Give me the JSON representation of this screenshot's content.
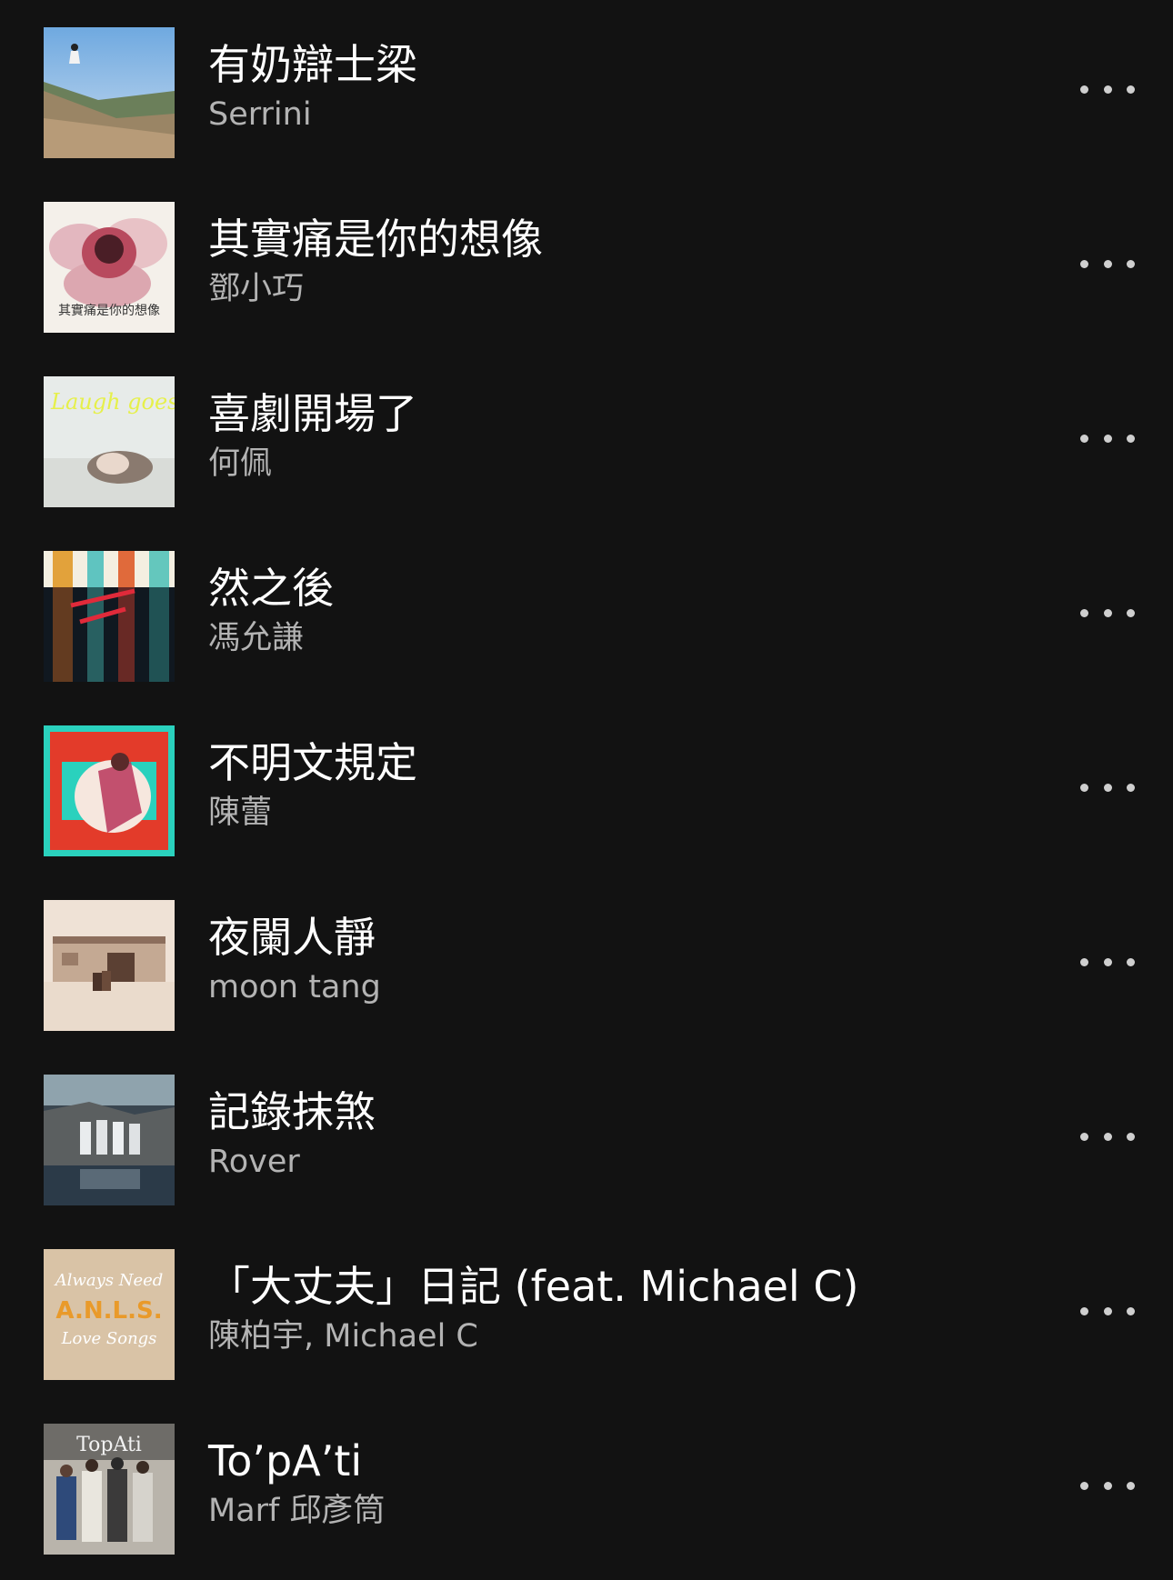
{
  "tracks": [
    {
      "title": "有奶辯士梁",
      "artist": "Serrini",
      "cover_icon": "album-cover-hillside"
    },
    {
      "title": "其實痛是你的想像",
      "artist": "鄧小巧",
      "cover_icon": "album-cover-flower",
      "cover_text": "其實痛是你的想像"
    },
    {
      "title": "喜劇開場了",
      "artist": "何佩",
      "cover_icon": "album-cover-portrait-lying",
      "cover_text": "Laugh goes on"
    },
    {
      "title": "然之後",
      "artist": "馮允謙",
      "cover_icon": "album-cover-neon-reflection"
    },
    {
      "title": "不明文規定",
      "artist": "陳蕾",
      "cover_icon": "album-cover-red-horse"
    },
    {
      "title": "夜闌人靜",
      "artist": "moon tang",
      "cover_icon": "album-cover-building-horses"
    },
    {
      "title": "記錄抹煞",
      "artist": "Rover",
      "cover_icon": "album-cover-rocks-band"
    },
    {
      "title": "「大丈夫」日記 (feat. Michael C)",
      "artist": "陳柏宇, Michael C",
      "cover_icon": "album-cover-anls",
      "cover_text_top": "Always Need",
      "cover_text_mid": "A.N.L.S.",
      "cover_text_bot": "Love Songs"
    },
    {
      "title": "To’pA’ti",
      "artist": "Marf 邱彥筒",
      "cover_icon": "album-cover-group-photo",
      "cover_text": "TopAti"
    }
  ],
  "colors": {
    "background": "#121212",
    "title": "#ffffff",
    "artist": "#b3b3b3",
    "more_icon": "#cfcfcf"
  },
  "more_icon": "more-options-icon"
}
